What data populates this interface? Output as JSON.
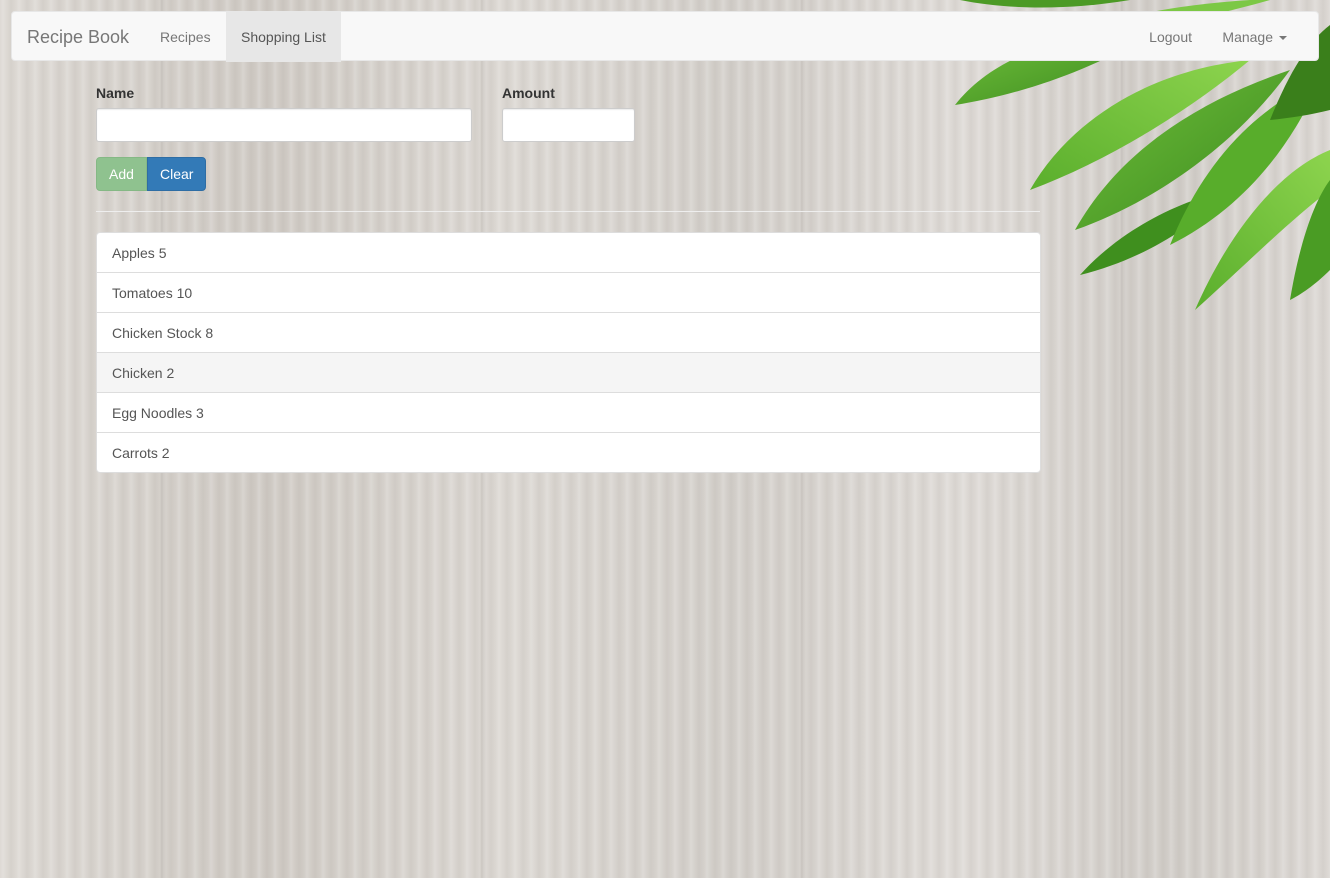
{
  "navbar": {
    "brand": "Recipe Book",
    "links": [
      {
        "label": "Recipes",
        "active": false
      },
      {
        "label": "Shopping List",
        "active": true
      }
    ],
    "right_links": {
      "logout": "Logout",
      "manage": "Manage"
    }
  },
  "form": {
    "name_label": "Name",
    "name_value": "",
    "amount_label": "Amount",
    "amount_value": "",
    "add_label": "Add",
    "clear_label": "Clear"
  },
  "shopping_list": [
    {
      "text": "Apples 5"
    },
    {
      "text": "Tomatoes 10"
    },
    {
      "text": "Chicken Stock 8"
    },
    {
      "text": "Chicken 2",
      "hovered": true
    },
    {
      "text": "Egg Noodles 3"
    },
    {
      "text": "Carrots 2"
    }
  ],
  "colors": {
    "add_button": "#8fc28f",
    "clear_button": "#337ab7",
    "navbar_bg": "#f8f8f8",
    "active_tab_bg": "#e7e7e7",
    "leaf_green": "#4f9e2a"
  },
  "background": {
    "texture": "light-wood-planks",
    "decoration": "green-leaves-top-right"
  }
}
